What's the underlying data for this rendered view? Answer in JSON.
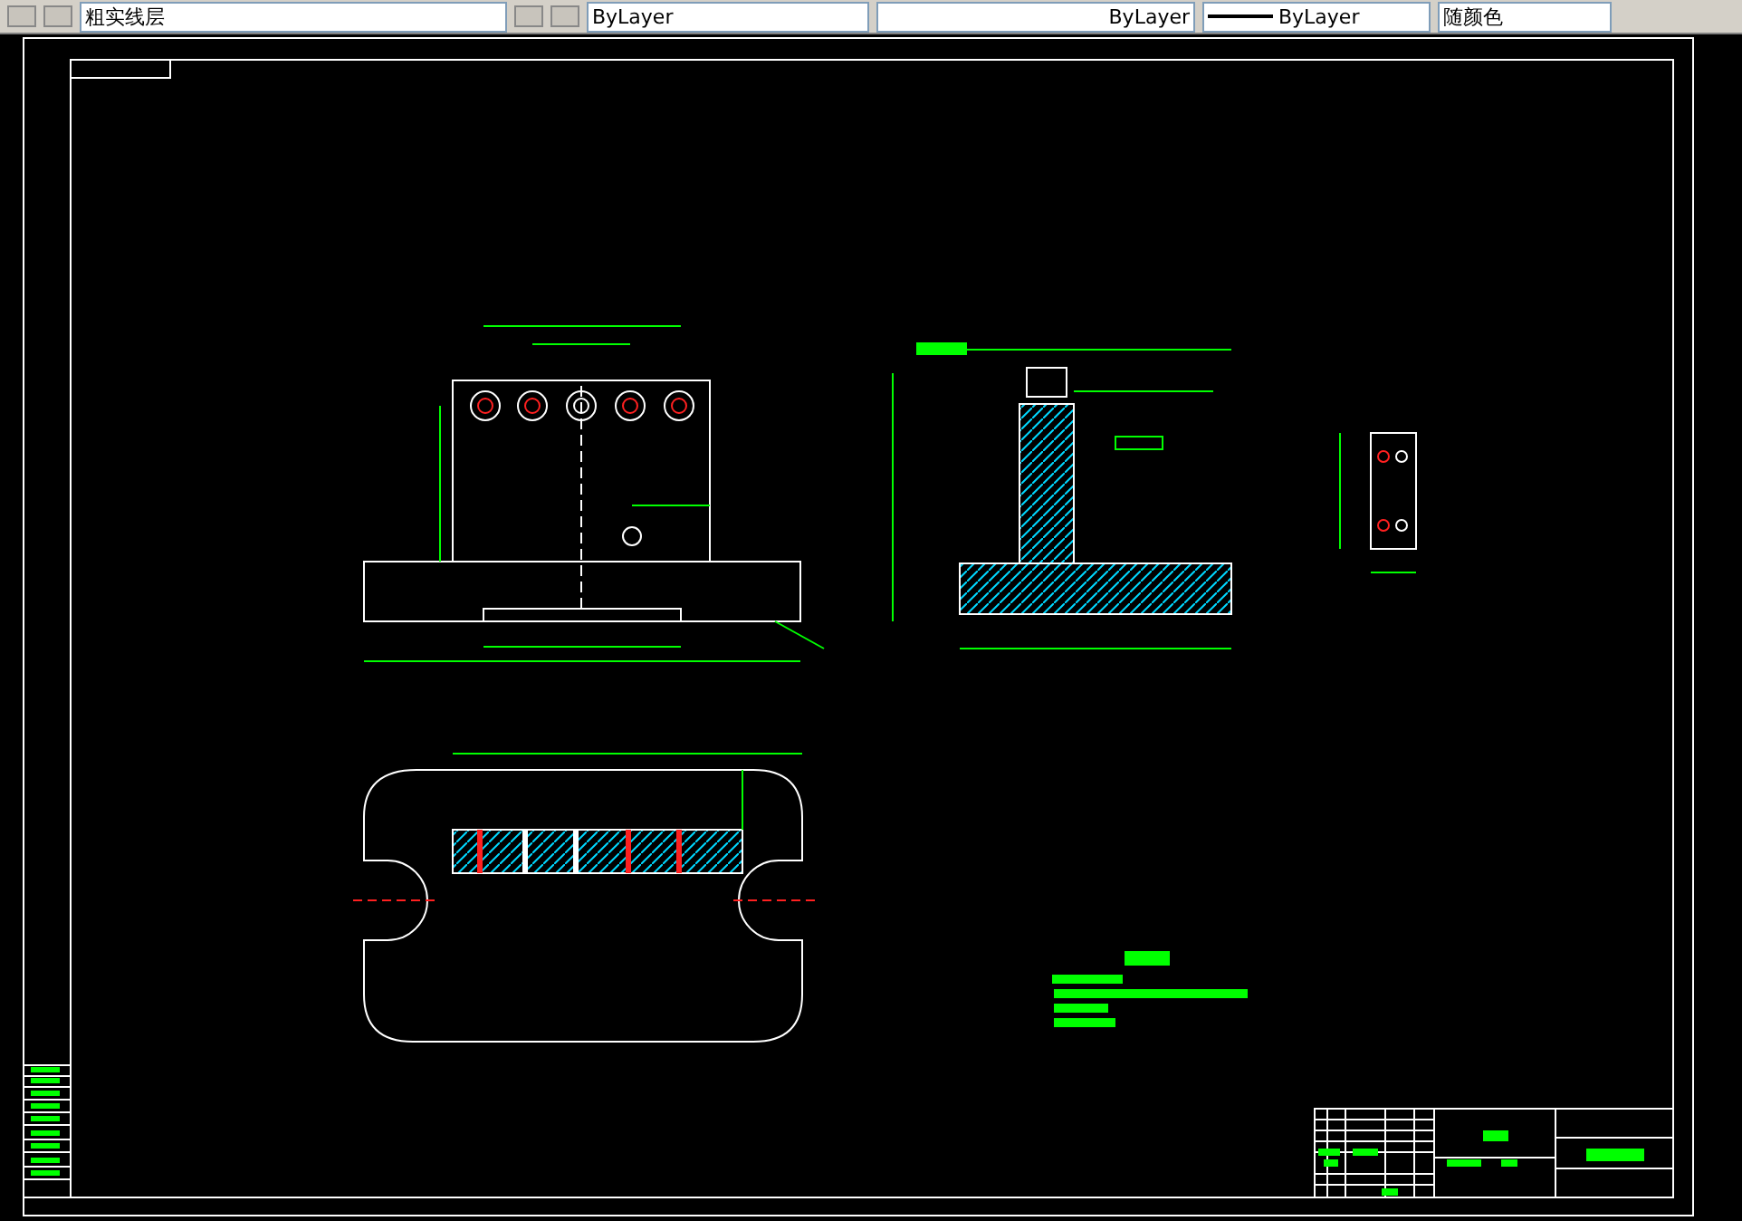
{
  "toolbar": {
    "layer": "粗实线层",
    "color_setting": "ByLayer",
    "linetype": "ByLayer",
    "lineweight": "ByLayer",
    "plot_style": "随颜色"
  }
}
